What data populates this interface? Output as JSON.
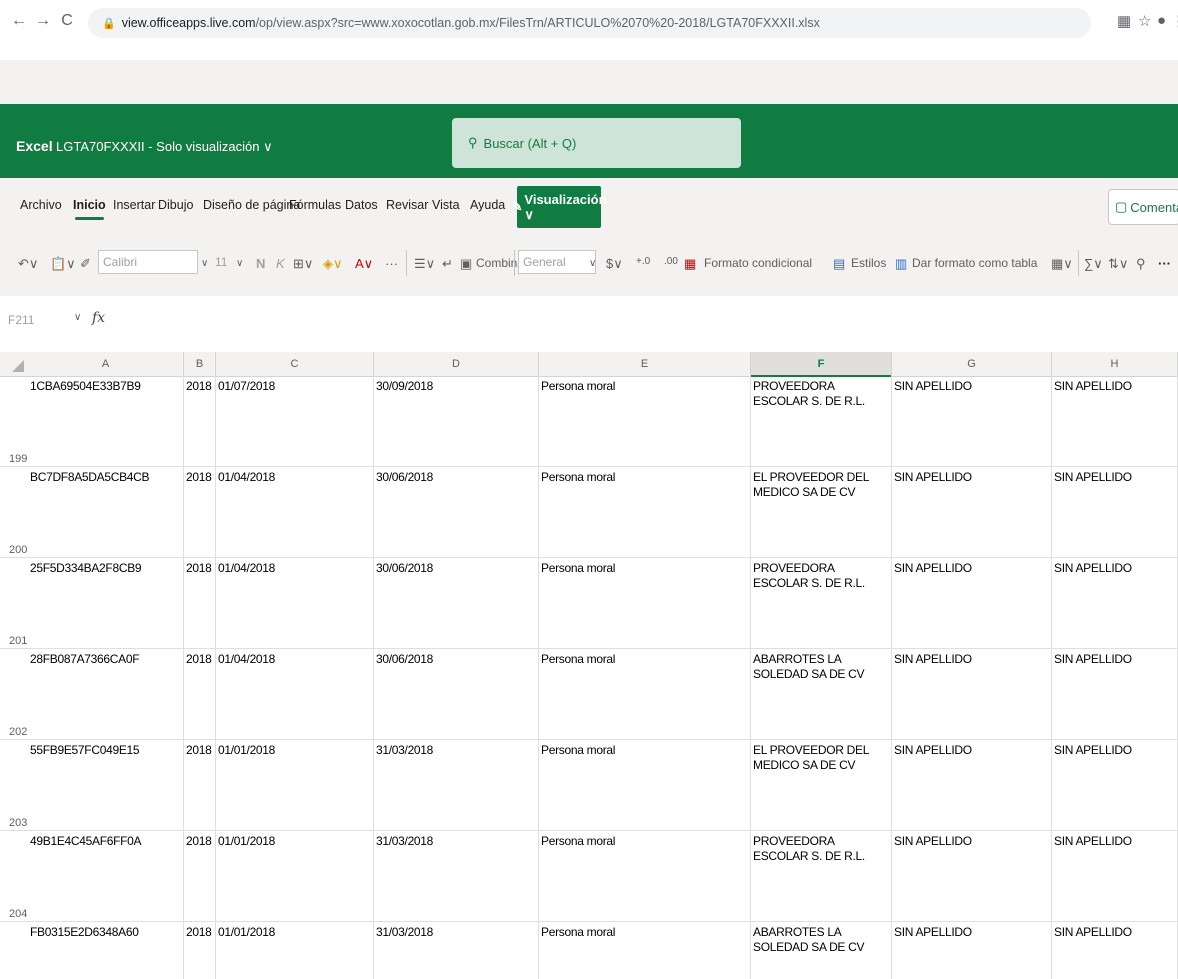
{
  "browser": {
    "back": "←",
    "forward": "→",
    "reload": "C",
    "url_host": "view.officeapps.live.com",
    "url_path": "/op/view.aspx?src=www.xoxocotlan.gob.mx/FilesTrn/ARTICULO%2070%20-2018/LGTA70FXXXII.xlsx"
  },
  "excel": {
    "app_name": "Excel",
    "file_title": "LGTA70FXXXII - Solo visualización ∨",
    "search_placeholder": "Buscar (Alt + Q)"
  },
  "menu": {
    "items": [
      "Archivo",
      "Inicio",
      "Insertar",
      "Dibujo",
      "Diseño de página",
      "Fórmulas",
      "Datos",
      "Revisar",
      "Vista",
      "Ayuda"
    ],
    "active": "Inicio",
    "view_mode": "Visualización ∨",
    "comments": "Comentarios"
  },
  "toolbar": {
    "font_name": "Calibri",
    "font_size": "11",
    "bold": "N",
    "italic": "K",
    "merge": "Combinar",
    "number_format": "General",
    "conditional": "Formato condicional",
    "styles": "Estilos",
    "table_format": "Dar formato como tabla",
    "more": "···"
  },
  "formula_bar": {
    "cell_ref": "F211",
    "fx": "fx"
  },
  "columns": [
    "A",
    "B",
    "C",
    "D",
    "E",
    "F",
    "G",
    "H"
  ],
  "selected_column": "F",
  "rows": [
    {
      "num": "199",
      "a": "1CBA69504E33B7B9",
      "b": "2018",
      "c": "01/07/2018",
      "d": "30/09/2018",
      "e": "Persona moral",
      "f": "PROVEEDORA ESCOLAR S. DE R.L.",
      "g": "SIN APELLIDO",
      "h": "SIN APELLIDO"
    },
    {
      "num": "200",
      "a": "BC7DF8A5DA5CB4CB",
      "b": "2018",
      "c": "01/04/2018",
      "d": "30/06/2018",
      "e": "Persona moral",
      "f": "EL PROVEEDOR DEL MEDICO SA DE CV",
      "g": "SIN APELLIDO",
      "h": "SIN APELLIDO"
    },
    {
      "num": "201",
      "a": "25F5D334BA2F8CB9",
      "b": "2018",
      "c": "01/04/2018",
      "d": "30/06/2018",
      "e": "Persona moral",
      "f": "PROVEEDORA ESCOLAR S. DE R.L.",
      "g": "SIN APELLIDO",
      "h": "SIN APELLIDO"
    },
    {
      "num": "202",
      "a": "28FB087A7366CA0F",
      "b": "2018",
      "c": "01/04/2018",
      "d": "30/06/2018",
      "e": "Persona moral",
      "f": "ABARROTES LA SOLEDAD SA DE CV",
      "g": "SIN APELLIDO",
      "h": "SIN APELLIDO"
    },
    {
      "num": "203",
      "a": "55FB9E57FC049E15",
      "b": "2018",
      "c": "01/01/2018",
      "d": "31/03/2018",
      "e": "Persona moral",
      "f": "EL PROVEEDOR DEL MEDICO SA DE CV",
      "g": "SIN APELLIDO",
      "h": "SIN APELLIDO"
    },
    {
      "num": "204",
      "a": "49B1E4C45AF6FF0A",
      "b": "2018",
      "c": "01/01/2018",
      "d": "31/03/2018",
      "e": "Persona moral",
      "f": "PROVEEDORA ESCOLAR S. DE R.L.",
      "g": "SIN APELLIDO",
      "h": "SIN APELLIDO"
    },
    {
      "num": "",
      "a": "FB0315E2D6348A60",
      "b": "2018",
      "c": "01/01/2018",
      "d": "31/03/2018",
      "e": "Persona moral",
      "f": "ABARROTES LA SOLEDAD SA DE CV",
      "g": "SIN APELLIDO",
      "h": "SIN APELLIDO"
    }
  ]
}
